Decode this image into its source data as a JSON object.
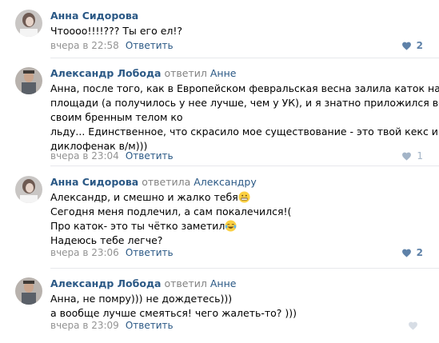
{
  "comments": [
    {
      "author": "Анна Сидорова",
      "reply_word": "",
      "reply_target": "",
      "lines": [
        "Чтоооо!!!!??? Ты его ел!?"
      ],
      "time": "вчера в 22:58",
      "reply_label": "Ответить",
      "likes": "2"
    },
    {
      "author": "Александр Лобода",
      "reply_word": "ответил",
      "reply_target": "Анне",
      "lines": [
        "Анна, после того, как в Европейском февральская весна залила каток на",
        "площади (а получилось у нее лучше, чем у УК), и я знатно приложился всем",
        "своим бренным телом ко",
        "льду... Единственное, что скрасило мое существование - это твой кекс и",
        "диклофенак в/м)))"
      ],
      "time": "вчера в 23:04",
      "reply_label": "Ответить",
      "likes": "1"
    },
    {
      "author": "Анна Сидорова",
      "reply_word": "ответила",
      "reply_target": "Александру",
      "lines": [
        "Александр, и смешно и жалко тебя",
        "Сегодня меня подлечил, а сам покалечился!(",
        "Про каток- это ты чётко заметил",
        "Надеюсь тебе легче?"
      ],
      "time": "вчера в 23:06",
      "reply_label": "Ответить",
      "likes": "2"
    },
    {
      "author": "Александр Лобода",
      "reply_word": "ответил",
      "reply_target": "Анне",
      "lines": [
        "Анна, не помру))) не дождетесь)))",
        "а вообще лучше смеяться! чего жалеть-то? )))"
      ],
      "time": "вчера в 23:09",
      "reply_label": "Ответить",
      "likes": ""
    }
  ],
  "emojis": [
    "grimacing-face",
    "tears-of-joy-face"
  ],
  "colors": {
    "link": "#2a5885",
    "muted": "#939393",
    "like": "#5e81a8",
    "separator": "#e7e8ec"
  }
}
